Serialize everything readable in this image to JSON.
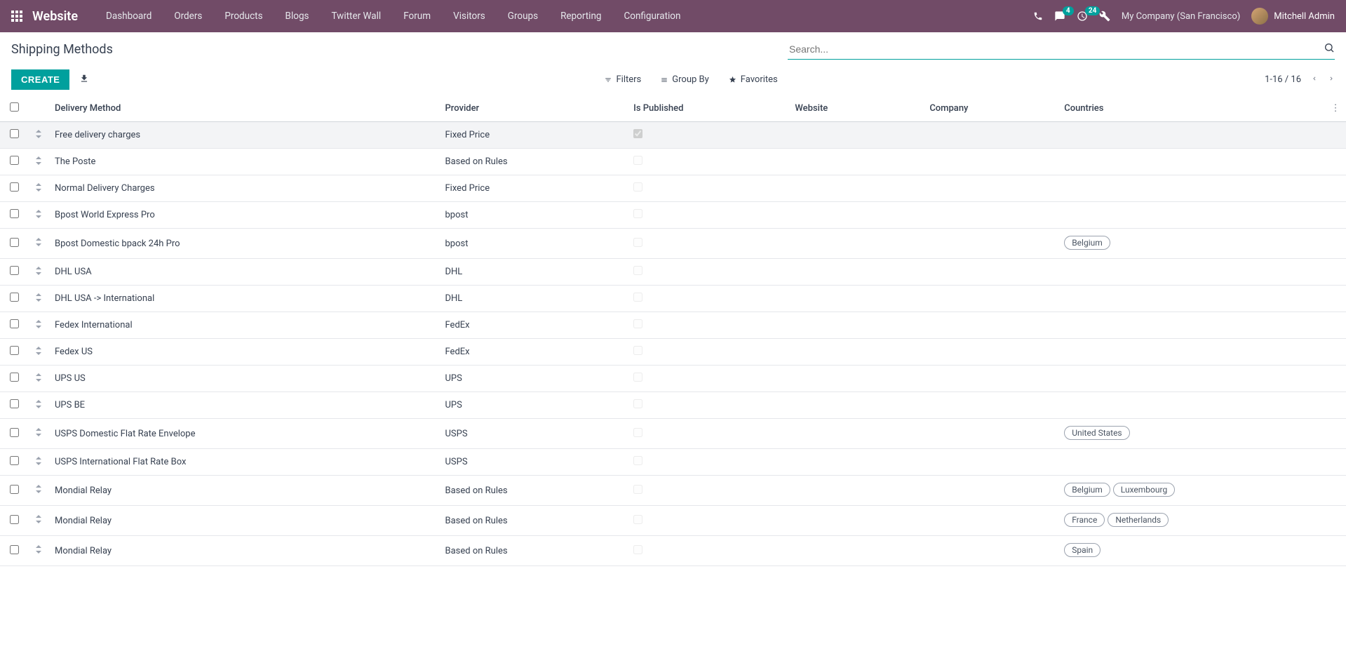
{
  "nav": {
    "brand": "Website",
    "menu": [
      "Dashboard",
      "Orders",
      "Products",
      "Blogs",
      "Twitter Wall",
      "Forum",
      "Visitors",
      "Groups",
      "Reporting",
      "Configuration"
    ],
    "messages_badge": "4",
    "activities_badge": "24",
    "company": "My Company (San Francisco)",
    "user": "Mitchell Admin"
  },
  "control": {
    "title": "Shipping Methods",
    "search_placeholder": "Search...",
    "create": "CREATE",
    "filters": "Filters",
    "groupby": "Group By",
    "favorites": "Favorites",
    "pager": "1-16 / 16"
  },
  "columns": {
    "method": "Delivery Method",
    "provider": "Provider",
    "published": "Is Published",
    "website": "Website",
    "company": "Company",
    "countries": "Countries"
  },
  "rows": [
    {
      "method": "Free delivery charges",
      "provider": "Fixed Price",
      "published": true,
      "countries": []
    },
    {
      "method": "The Poste",
      "provider": "Based on Rules",
      "published": false,
      "countries": []
    },
    {
      "method": "Normal Delivery Charges",
      "provider": "Fixed Price",
      "published": false,
      "countries": []
    },
    {
      "method": "Bpost World Express Pro",
      "provider": "bpost",
      "published": false,
      "countries": []
    },
    {
      "method": "Bpost Domestic bpack 24h Pro",
      "provider": "bpost",
      "published": false,
      "countries": [
        "Belgium"
      ]
    },
    {
      "method": "DHL USA",
      "provider": "DHL",
      "published": false,
      "countries": []
    },
    {
      "method": "DHL USA -> International",
      "provider": "DHL",
      "published": false,
      "countries": []
    },
    {
      "method": "Fedex International",
      "provider": "FedEx",
      "published": false,
      "countries": []
    },
    {
      "method": "Fedex US",
      "provider": "FedEx",
      "published": false,
      "countries": []
    },
    {
      "method": "UPS US",
      "provider": "UPS",
      "published": false,
      "countries": []
    },
    {
      "method": "UPS BE",
      "provider": "UPS",
      "published": false,
      "countries": []
    },
    {
      "method": "USPS Domestic Flat Rate Envelope",
      "provider": "USPS",
      "published": false,
      "countries": [
        "United States"
      ]
    },
    {
      "method": "USPS International Flat Rate Box",
      "provider": "USPS",
      "published": false,
      "countries": []
    },
    {
      "method": "Mondial Relay",
      "provider": "Based on Rules",
      "published": false,
      "countries": [
        "Belgium",
        "Luxembourg"
      ]
    },
    {
      "method": "Mondial Relay",
      "provider": "Based on Rules",
      "published": false,
      "countries": [
        "France",
        "Netherlands"
      ]
    },
    {
      "method": "Mondial Relay",
      "provider": "Based on Rules",
      "published": false,
      "countries": [
        "Spain"
      ]
    }
  ]
}
